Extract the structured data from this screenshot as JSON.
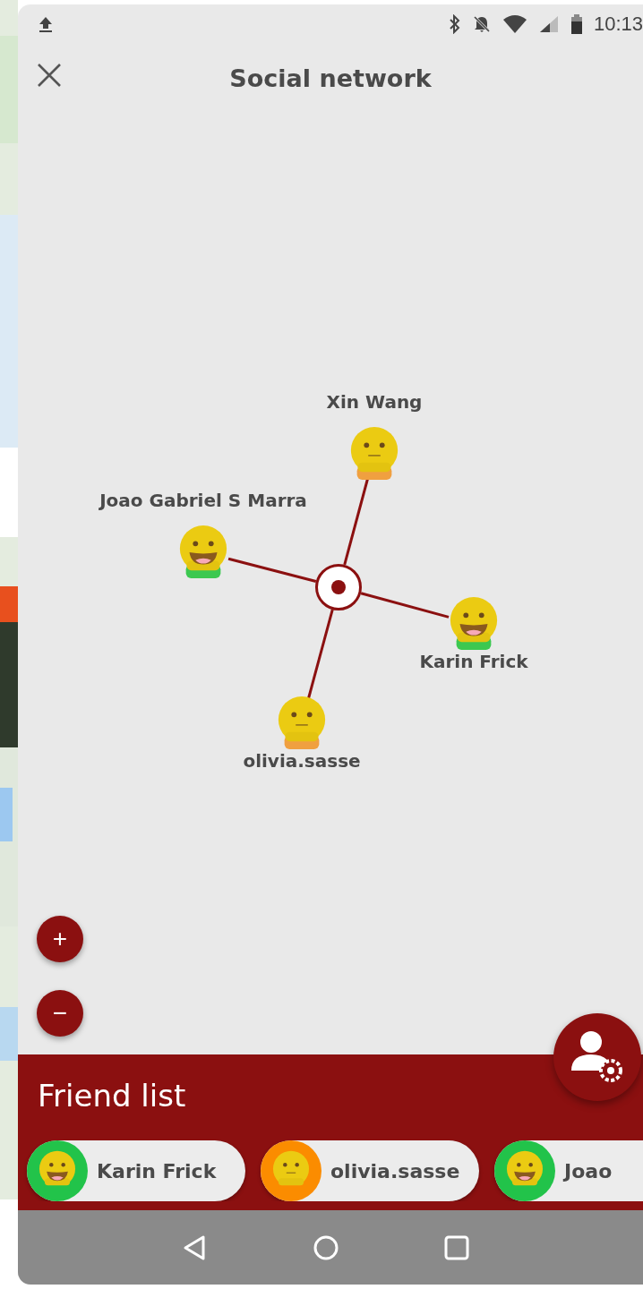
{
  "status_bar": {
    "time": "10:13"
  },
  "header": {
    "title": "Social network"
  },
  "graph": {
    "nodes": [
      {
        "name": "Xin Wang",
        "kind": "neutral",
        "color": "#f0a040"
      },
      {
        "name": "Joao Gabriel S Marra",
        "kind": "grin",
        "color": "#3cc850"
      },
      {
        "name": "Karin Frick",
        "kind": "grin",
        "color": "#3cc850"
      },
      {
        "name": "olivia.sasse",
        "kind": "neutral",
        "color": "#f0a040"
      }
    ]
  },
  "zoom_controls": [
    "+",
    "−"
  ],
  "friend_list": {
    "title": "Friend list",
    "friends": [
      {
        "name": "Karin Frick",
        "kind": "grin",
        "color": "#22c34a"
      },
      {
        "name": "olivia.sasse",
        "kind": "neutral",
        "color": "#fb8c00"
      },
      {
        "name": "Joao",
        "kind": "grin",
        "color": "#22c34a"
      }
    ]
  }
}
